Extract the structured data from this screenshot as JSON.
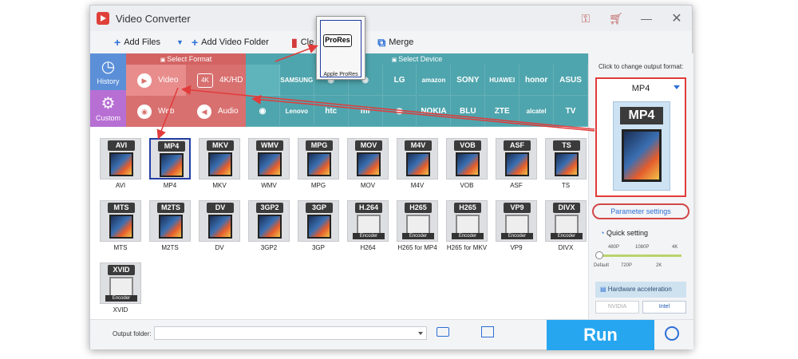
{
  "window": {
    "title": "Video Converter"
  },
  "toolbar": {
    "add_files": "Add Files",
    "add_video_folder": "Add Video Folder",
    "clear": "Cle",
    "merge": "Merge"
  },
  "section_labels": {
    "select_format": "Select Format",
    "select_device": "Select Device"
  },
  "side": {
    "history": "History",
    "custom": "Custom"
  },
  "format_categories": [
    {
      "label": "Video",
      "icon": "play-icon"
    },
    {
      "label": "4K/HD",
      "icon": "4k-icon"
    },
    {
      "label": "Web",
      "icon": "chrome-icon"
    },
    {
      "label": "Audio",
      "icon": "speaker-icon"
    }
  ],
  "devices": [
    [
      "",
      "SAMSUNG",
      "",
      "",
      "LG",
      "amazon",
      "SONY",
      "HUAWEI",
      "honor",
      "ASUS"
    ],
    [
      "",
      "Lenovo",
      "htc",
      "mi",
      "",
      "NOKIA",
      "BLU",
      "ZTE",
      "alcatel",
      "TV"
    ]
  ],
  "popup": {
    "badge": "ProRes",
    "caption": "Apple ProRes"
  },
  "formats": [
    {
      "name": "AVI",
      "badge": "AVI",
      "encoder": false
    },
    {
      "name": "MP4",
      "badge": "MP4",
      "encoder": false,
      "selected": true
    },
    {
      "name": "MKV",
      "badge": "MKV",
      "encoder": false
    },
    {
      "name": "WMV",
      "badge": "WMV",
      "encoder": false
    },
    {
      "name": "MPG",
      "badge": "MPG",
      "encoder": false
    },
    {
      "name": "MOV",
      "badge": "MOV",
      "encoder": false
    },
    {
      "name": "M4V",
      "badge": "M4V",
      "encoder": false
    },
    {
      "name": "VOB",
      "badge": "VOB",
      "encoder": false
    },
    {
      "name": "ASF",
      "badge": "ASF",
      "encoder": false
    },
    {
      "name": "TS",
      "badge": "TS",
      "encoder": false
    },
    {
      "name": "MTS",
      "badge": "MTS",
      "encoder": false
    },
    {
      "name": "M2TS",
      "badge": "M2TS",
      "encoder": false
    },
    {
      "name": "DV",
      "badge": "DV",
      "encoder": false
    },
    {
      "name": "3GP2",
      "badge": "3GP2",
      "encoder": false
    },
    {
      "name": "3GP",
      "badge": "3GP",
      "encoder": false
    },
    {
      "name": "H264",
      "badge": "H.264",
      "encoder": true
    },
    {
      "name": "H265 for MP4",
      "badge": "H265",
      "encoder": true
    },
    {
      "name": "H265 for MKV",
      "badge": "H265",
      "encoder": true
    },
    {
      "name": "VP9",
      "badge": "VP9",
      "encoder": true
    },
    {
      "name": "DIVX",
      "badge": "DIVX",
      "encoder": true
    },
    {
      "name": "XVID",
      "badge": "XVID",
      "encoder": true
    }
  ],
  "encoder_text": "Encoder",
  "right_panel": {
    "change_label": "Click to change output format:",
    "output_format": "MP4",
    "param_settings": "Parameter settings",
    "quick_setting": "Quick setting",
    "slider_top": [
      "480P",
      "1080P",
      "4K"
    ],
    "slider_bottom": [
      "Default",
      "720P",
      "2K"
    ],
    "hw_accel": "Hardware acceleration",
    "nvidia": "NVIDIA",
    "intel": "Intel"
  },
  "bottom": {
    "output_folder_label": "Output folder:",
    "run": "Run"
  },
  "colors": {
    "run": "#27a6f0",
    "format_red": "#d8706f",
    "device_teal": "#4fa5ad",
    "annotation_red": "#e23b3b"
  }
}
